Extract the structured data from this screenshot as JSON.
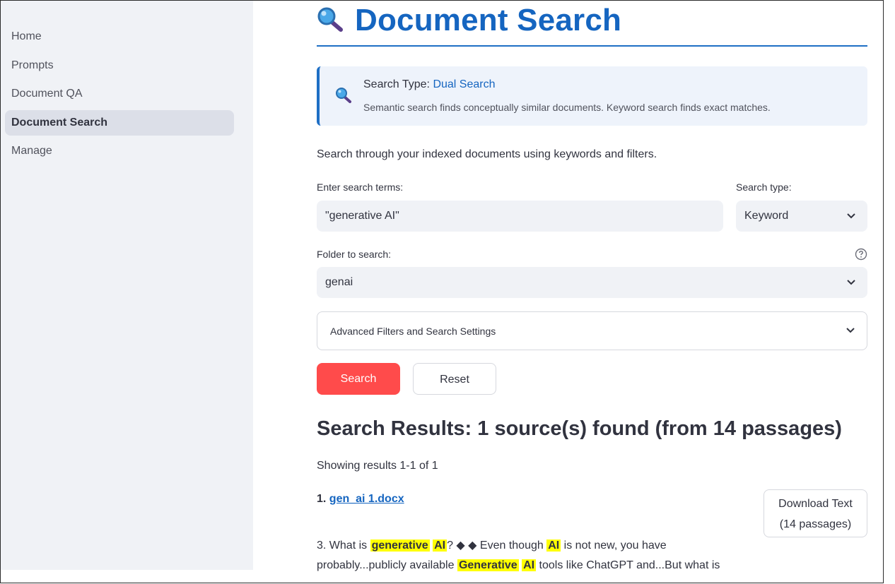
{
  "sidebar": {
    "items": [
      {
        "label": "Home",
        "active": false
      },
      {
        "label": "Prompts",
        "active": false
      },
      {
        "label": "Document QA",
        "active": false
      },
      {
        "label": "Document Search",
        "active": true
      },
      {
        "label": "Manage",
        "active": false
      }
    ]
  },
  "header": {
    "icon": "magnifying-glass-icon",
    "title": "Document Search"
  },
  "info": {
    "label": "Search Type: ",
    "value": "Dual Search",
    "description": "Semantic search finds conceptually similar documents. Keyword search finds exact matches."
  },
  "intro": "Search through your indexed documents using keywords and filters.",
  "form": {
    "search_terms_label": "Enter search terms:",
    "search_terms_value": "\"generative AI\"",
    "search_type_label": "Search type:",
    "search_type_value": "Keyword",
    "folder_label": "Folder to search:",
    "folder_value": "genai",
    "advanced_label": "Advanced Filters and Search Settings",
    "search_button": "Search",
    "reset_button": "Reset"
  },
  "results": {
    "title": "Search Results: 1 source(s) found (from 14 passages)",
    "showing": "Showing results 1-1 of 1",
    "items": [
      {
        "index": "1. ",
        "filename": "gen_ai 1.docx",
        "download_label": "Download Text",
        "download_count": "(14 passages)",
        "snippet": {
          "p1": "3. What is ",
          "h1": "generative",
          "h2": "AI",
          "p2": "? ◆ ◆ Even though ",
          "h3": "AI",
          "p3": " is not new, you have probably...publicly available ",
          "h4": "Generative",
          "h5": "AI",
          "p4": " tools like ChatGPT and...But what is"
        }
      }
    ]
  },
  "colors": {
    "accent": "#1565c0",
    "primary_button": "#ff4b4b",
    "highlight": "#ffff00",
    "sidebar_bg": "#f0f2f6"
  }
}
